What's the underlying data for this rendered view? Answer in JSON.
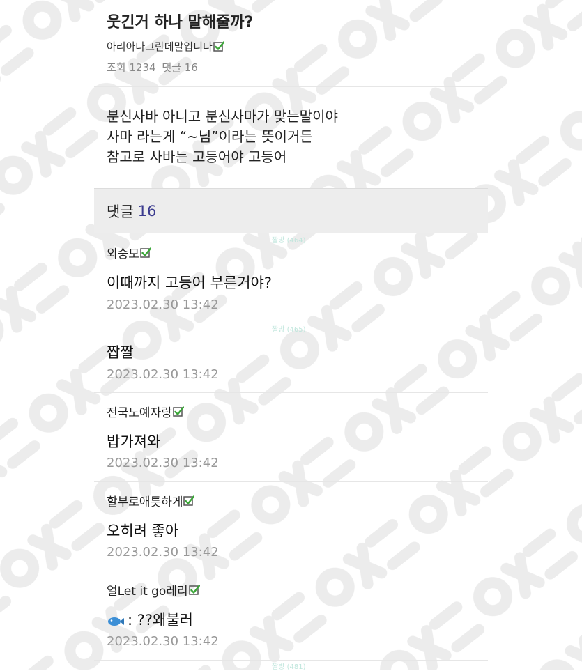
{
  "post": {
    "title": "웃긴거 하나 말해줄까?",
    "author": "아리아나그란데말입니다",
    "views_label": "조회 1234",
    "comments_label": "댓글 16",
    "body_lines": [
      "분신사바 아니고 분신사마가 맞는말이야",
      "사마 라는게 “~님”이라는 뜻이거든",
      "참고로 사바는 고등어야 고등어"
    ]
  },
  "comments_header": {
    "label": "댓글",
    "count": "16"
  },
  "faint_labels": [
    "짤방 (464)",
    "짤방 (465)",
    "짤방 (481)"
  ],
  "comments": [
    {
      "author": "외숭모",
      "verified": true,
      "text": "이때까지 고등어 부른거야?",
      "date": "2023.02.30 13:42"
    },
    {
      "author": "",
      "verified": false,
      "text": "짭짤",
      "date": "2023.02.30 13:42"
    },
    {
      "author": "전국노예자랑",
      "verified": true,
      "text": "밥가져와",
      "date": "2023.02.30 13:42"
    },
    {
      "author": "할부로애틋하게",
      "verified": true,
      "text": "오히려 좋아",
      "date": "2023.02.30 13:42"
    },
    {
      "author": "얼Let it go레리",
      "verified": true,
      "text": ": ??왜불러",
      "date": "2023.02.30 13:42",
      "icon": "fish-icon"
    }
  ],
  "colors": {
    "accent": "#3b3b8f",
    "check_green": "#3aa637",
    "muted": "#999999",
    "header_bg": "#ededed"
  }
}
